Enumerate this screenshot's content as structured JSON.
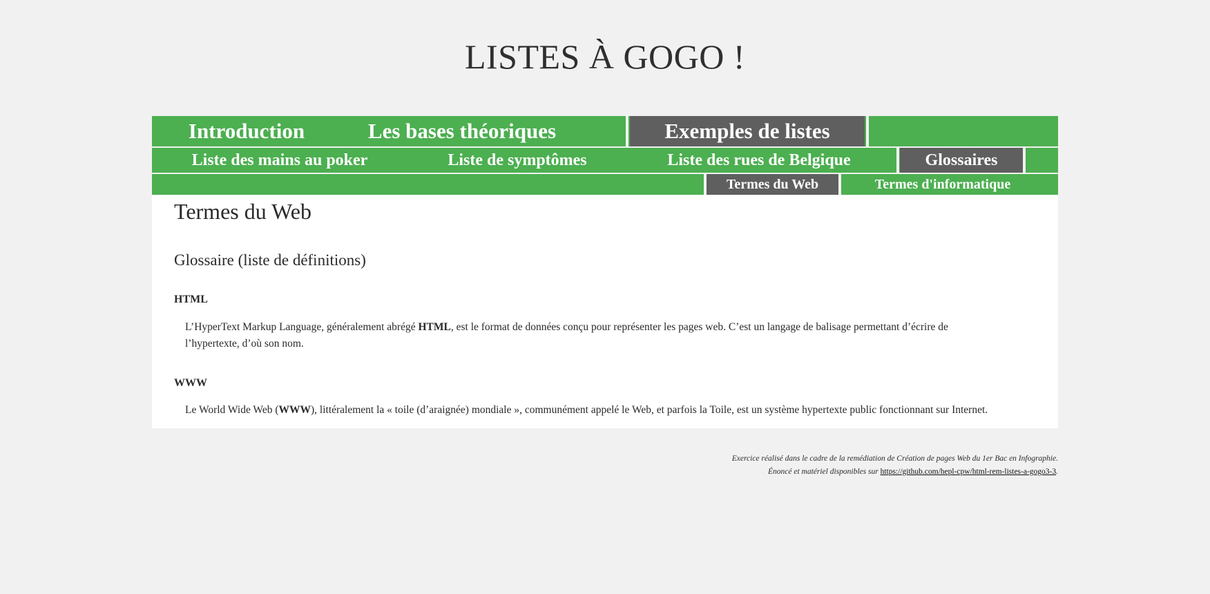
{
  "header": {
    "title": "LISTES À GOGO !"
  },
  "nav": {
    "level1": [
      {
        "label": "Introduction",
        "active": false
      },
      {
        "label": "Les bases théoriques",
        "active": false
      },
      {
        "label": "Exemples de listes",
        "active": true
      }
    ],
    "level2": [
      {
        "label": "Liste des mains au poker",
        "active": false
      },
      {
        "label": "Liste de symptômes",
        "active": false
      },
      {
        "label": "Liste des rues de Belgique",
        "active": false
      },
      {
        "label": "Glossaires",
        "active": true
      }
    ],
    "level3": [
      {
        "label": "Termes du Web",
        "active": true
      },
      {
        "label": "Termes d'informatique",
        "active": false
      }
    ]
  },
  "main": {
    "page_heading": "Termes du Web",
    "section_heading": "Glossaire (liste de définitions)",
    "glossary": [
      {
        "term": "HTML",
        "definition_before": "L’HyperText Markup Language, généralement abrégé ",
        "definition_bold": "HTML",
        "definition_after": ", est le format de données conçu pour représenter les pages web. C’est un langage de balisage permettant d’écrire de l’hypertexte, d’où son nom."
      },
      {
        "term": "WWW",
        "definition_before": "Le World Wide Web (",
        "definition_bold": "WWW",
        "definition_after": "), littéralement la « toile (d’araignée) mondiale », communément appelé le Web, et parfois la Toile, est un système hypertexte public fonctionnant sur Internet."
      }
    ]
  },
  "footer": {
    "line1": "Exercice réalisé dans le cadre de la remédiation de Création de pages Web du 1er Bac en Infographie.",
    "line2_prefix": "Énoncé et matériel disponibles sur ",
    "link_text": "https://github.com/hepl-cpw/html-rem-listes-a-gogo3-3",
    "line2_suffix": "."
  },
  "colors": {
    "nav_green": "#4caf50",
    "nav_active": "#5f5f5f",
    "background": "#f1f1f1",
    "content_bg": "#ffffff",
    "text": "#2a2a2a"
  }
}
